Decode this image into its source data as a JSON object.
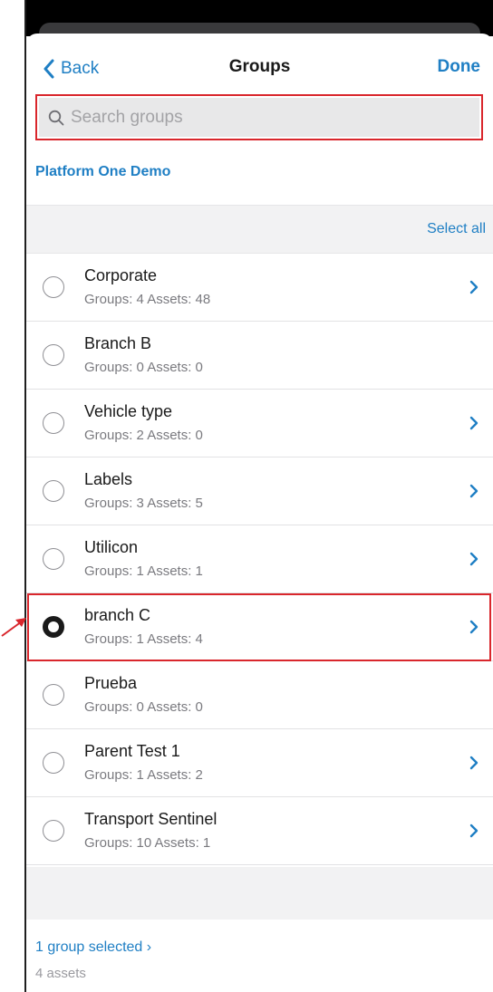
{
  "nav": {
    "back_label": "Back",
    "title": "Groups",
    "done_label": "Done"
  },
  "search": {
    "placeholder": "Search groups",
    "value": ""
  },
  "account": {
    "name": "Platform One Demo"
  },
  "list_header": {
    "select_all_label": "Select all"
  },
  "groups": [
    {
      "name": "Corporate",
      "meta": "Groups: 4 Assets: 48",
      "selected": false,
      "has_children": true
    },
    {
      "name": "Branch B",
      "meta": "Groups: 0 Assets: 0",
      "selected": false,
      "has_children": false
    },
    {
      "name": "Vehicle type",
      "meta": "Groups: 2 Assets: 0",
      "selected": false,
      "has_children": true
    },
    {
      "name": "Labels",
      "meta": "Groups: 3 Assets: 5",
      "selected": false,
      "has_children": true
    },
    {
      "name": "Utilicon",
      "meta": "Groups: 1 Assets: 1",
      "selected": false,
      "has_children": true
    },
    {
      "name": "branch C",
      "meta": "Groups: 1 Assets: 4",
      "selected": true,
      "has_children": true
    },
    {
      "name": "Prueba",
      "meta": "Groups: 0 Assets: 0",
      "selected": false,
      "has_children": false
    },
    {
      "name": "Parent Test 1",
      "meta": "Groups: 1 Assets: 2",
      "selected": false,
      "has_children": true
    },
    {
      "name": "Transport Sentinel",
      "meta": "Groups: 10 Assets: 1",
      "selected": false,
      "has_children": true
    }
  ],
  "footer": {
    "selected_label": "1 group selected ›",
    "assets_label": "4 assets"
  },
  "colors": {
    "accent": "#1f7fc4",
    "highlight": "#d9262c",
    "text": "#1a1a1a",
    "subtext": "#7a7a7f",
    "band": "#f2f2f3"
  },
  "icons": {
    "back": "chevron-left-icon",
    "search": "magnifier-icon",
    "disclosure": "chevron-right-icon",
    "radio_off": "radio-empty-icon",
    "radio_on": "radio-filled-icon",
    "annotation": "arrow-pointer-icon"
  }
}
